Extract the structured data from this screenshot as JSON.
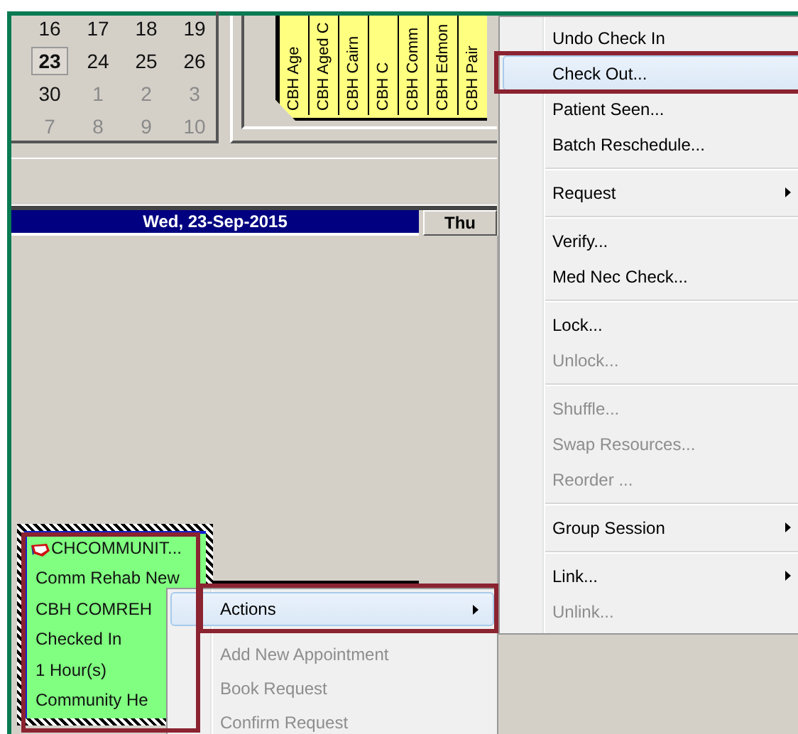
{
  "calendar": {
    "weeks": [
      [
        {
          "label": "16",
          "muted": false,
          "selected": false
        },
        {
          "label": "17",
          "muted": false,
          "selected": false
        },
        {
          "label": "18",
          "muted": false,
          "selected": false
        },
        {
          "label": "19",
          "muted": false,
          "selected": false
        }
      ],
      [
        {
          "label": "23",
          "muted": false,
          "selected": true
        },
        {
          "label": "24",
          "muted": false,
          "selected": false
        },
        {
          "label": "25",
          "muted": false,
          "selected": false
        },
        {
          "label": "26",
          "muted": false,
          "selected": false
        }
      ],
      [
        {
          "label": "30",
          "muted": false,
          "selected": false
        },
        {
          "label": "1",
          "muted": true,
          "selected": false
        },
        {
          "label": "2",
          "muted": true,
          "selected": false
        },
        {
          "label": "3",
          "muted": true,
          "selected": false
        }
      ],
      [
        {
          "label": "7",
          "muted": true,
          "selected": false
        },
        {
          "label": "8",
          "muted": true,
          "selected": false
        },
        {
          "label": "9",
          "muted": true,
          "selected": false
        },
        {
          "label": "10",
          "muted": true,
          "selected": false
        }
      ]
    ]
  },
  "resources": [
    "CBH Age",
    "CBH Aged C",
    "CBH Cairn",
    "CBH C",
    "CBH Comm",
    "CBH Edmon",
    "CBH Pair"
  ],
  "day_tabs": [
    {
      "label": "Wed, 23-Sep-2015",
      "selected": true
    },
    {
      "label": "Thu",
      "selected": false
    }
  ],
  "appointment": {
    "title": "CHCOMMUNIT...",
    "lines": [
      "Comm Rehab New",
      "CBH COMREH",
      "Checked In",
      "1 Hour(s)",
      "Community He"
    ],
    "annotated": true
  },
  "context_menu": {
    "items": [
      {
        "kind": "item",
        "label": "Actions",
        "disabled": false,
        "selected": true,
        "submenu": true,
        "annotated": true
      },
      {
        "kind": "separator"
      },
      {
        "kind": "item",
        "label": "Add New Appointment",
        "disabled": true,
        "selected": false,
        "submenu": false,
        "annotated": false
      },
      {
        "kind": "item",
        "label": "Book Request",
        "disabled": true,
        "selected": false,
        "submenu": false,
        "annotated": false
      },
      {
        "kind": "item",
        "label": "Confirm Request",
        "disabled": true,
        "selected": false,
        "submenu": false,
        "annotated": false
      }
    ]
  },
  "actions_submenu": {
    "items": [
      {
        "kind": "item",
        "label": "Undo Check In",
        "disabled": false,
        "selected": false,
        "submenu": false,
        "annotated": false
      },
      {
        "kind": "item",
        "label": "Check Out...",
        "disabled": false,
        "selected": true,
        "submenu": false,
        "annotated": true
      },
      {
        "kind": "item",
        "label": "Patient Seen...",
        "disabled": false,
        "selected": false,
        "submenu": false,
        "annotated": false
      },
      {
        "kind": "item",
        "label": "Batch Reschedule...",
        "disabled": false,
        "selected": false,
        "submenu": false,
        "annotated": false
      },
      {
        "kind": "separator"
      },
      {
        "kind": "item",
        "label": "Request",
        "disabled": false,
        "selected": false,
        "submenu": true,
        "annotated": false
      },
      {
        "kind": "separator"
      },
      {
        "kind": "item",
        "label": "Verify...",
        "disabled": false,
        "selected": false,
        "submenu": false,
        "annotated": false
      },
      {
        "kind": "item",
        "label": "Med Nec Check...",
        "disabled": false,
        "selected": false,
        "submenu": false,
        "annotated": false
      },
      {
        "kind": "separator"
      },
      {
        "kind": "item",
        "label": "Lock...",
        "disabled": false,
        "selected": false,
        "submenu": false,
        "annotated": false
      },
      {
        "kind": "item",
        "label": "Unlock...",
        "disabled": true,
        "selected": false,
        "submenu": false,
        "annotated": false
      },
      {
        "kind": "separator"
      },
      {
        "kind": "item",
        "label": "Shuffle...",
        "disabled": true,
        "selected": false,
        "submenu": false,
        "annotated": false
      },
      {
        "kind": "item",
        "label": "Swap Resources...",
        "disabled": true,
        "selected": false,
        "submenu": false,
        "annotated": false
      },
      {
        "kind": "item",
        "label": "Reorder ...",
        "disabled": true,
        "selected": false,
        "submenu": false,
        "annotated": false
      },
      {
        "kind": "separator"
      },
      {
        "kind": "item",
        "label": "Group Session",
        "disabled": false,
        "selected": false,
        "submenu": true,
        "annotated": false
      },
      {
        "kind": "separator"
      },
      {
        "kind": "item",
        "label": "Link...",
        "disabled": false,
        "selected": false,
        "submenu": true,
        "annotated": false
      },
      {
        "kind": "item",
        "label": "Unlink...",
        "disabled": true,
        "selected": false,
        "submenu": false,
        "annotated": false
      }
    ]
  }
}
